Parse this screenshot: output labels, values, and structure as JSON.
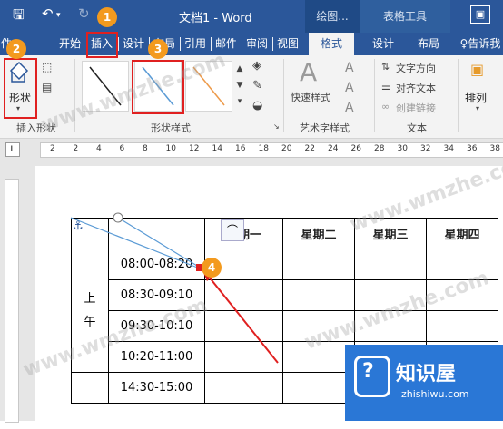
{
  "window": {
    "title": "文档1 - Word",
    "contextual_groups": [
      "绘图...",
      "表格工具"
    ],
    "qat_icons": [
      "save-icon",
      "undo-icon",
      "redo-icon"
    ]
  },
  "tabs": [
    "件",
    "开始",
    "插入",
    "设计",
    "布局",
    "引用",
    "邮件",
    "审阅",
    "视图",
    "格式",
    "设计",
    "布局"
  ],
  "tell_me": "告诉我",
  "ribbon": {
    "insert_shape": {
      "button_label": "形状",
      "group_label": "插入形状"
    },
    "shape_styles": {
      "group_label": "形状样式"
    },
    "wordart": {
      "quick_styles": "快速样式",
      "group_label": "艺术字样式",
      "letter": "A"
    },
    "text": {
      "items": [
        "文字方向",
        "对齐文本",
        "创建链接"
      ],
      "group_label": "文本"
    },
    "arrange": {
      "label": "排列"
    }
  },
  "badges": [
    "1",
    "2",
    "3",
    "4"
  ],
  "ruler": {
    "h_marks": [
      "2",
      "2",
      "4",
      "6",
      "8",
      "10",
      "12",
      "14",
      "16",
      "18",
      "20",
      "22",
      "24",
      "26",
      "28",
      "30",
      "32",
      "34",
      "36",
      "38"
    ]
  },
  "table": {
    "headers": [
      "星期一",
      "星期二",
      "星期三",
      "星期四"
    ],
    "period_label": [
      "上",
      "午"
    ],
    "times": [
      "08:00-08:20",
      "08:30-09:10",
      "09:30-10:10",
      "10:20-11:00",
      "14:30-15:00"
    ]
  },
  "watermarks": [
    "www.wmzhe.com",
    "www.wmzhe.com",
    "www.wmzhe.com",
    "www.wmzhe.com"
  ],
  "brand": {
    "name": "知识屋",
    "url": "zhishiwu.com"
  },
  "colors": {
    "title_bar": "#2b579a",
    "highlight": "#e02020",
    "badge": "#f39a1e",
    "brand": "#2a77d6"
  }
}
